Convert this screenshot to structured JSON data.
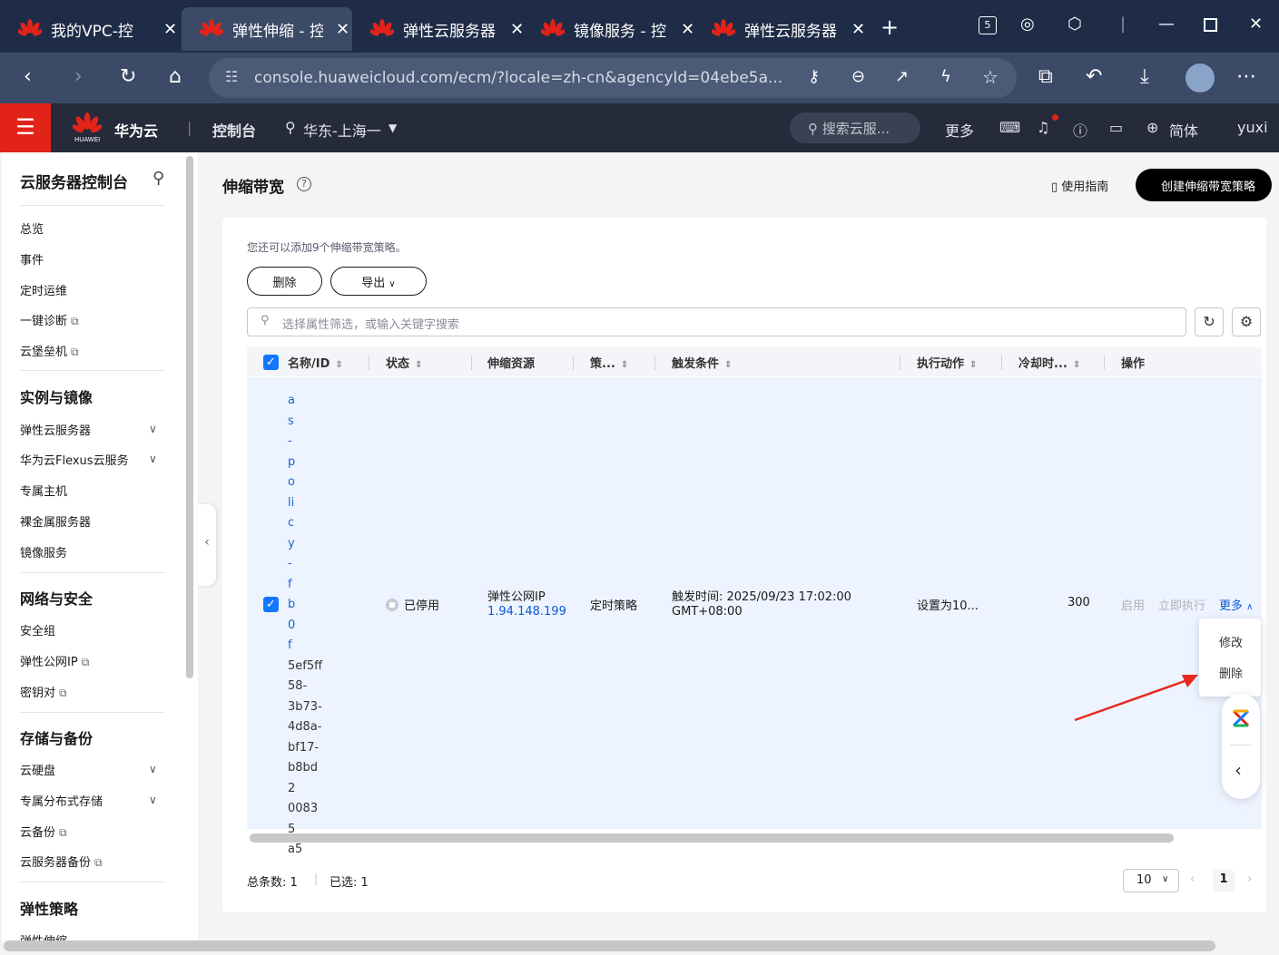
{
  "browser": {
    "tabs": [
      {
        "title": "我的VPC-控"
      },
      {
        "title": "弹性伸缩 - 控"
      },
      {
        "title": "弹性云服务器"
      },
      {
        "title": "镜像服务 - 控"
      },
      {
        "title": "弹性云服务器"
      }
    ],
    "url": "console.huaweicloud.com/ecm/?locale=zh-cn&agencyId=04ebe5a...",
    "badge": "5"
  },
  "console": {
    "brand": "华为云",
    "brand_small": "HUAWEI",
    "control": "控制台",
    "region": "华东-上海一",
    "search": "搜索云服...",
    "more": "更多",
    "lang": "简体",
    "user": "yuxi"
  },
  "sidebar": {
    "title": "云服务器控制台",
    "top_items": [
      "总览",
      "事件",
      "定时运维",
      "一键诊断",
      "云堡垒机"
    ],
    "sections": [
      {
        "title": "实例与镜像",
        "items": [
          "弹性云服务器",
          "华为云Flexus云服务",
          "专属主机",
          "裸金属服务器",
          "镜像服务"
        ]
      },
      {
        "title": "网络与安全",
        "items": [
          "安全组",
          "弹性公网IP",
          "密钥对"
        ]
      },
      {
        "title": "存储与备份",
        "items": [
          "云硬盘",
          "专属分布式存储",
          "云备份",
          "云服务器备份"
        ]
      },
      {
        "title": "弹性策略",
        "items": [
          "弹性伸缩"
        ]
      }
    ]
  },
  "page": {
    "title": "伸缩带宽",
    "guide": "使用指南",
    "create": "创建伸缩带宽策略",
    "hint": "您还可以添加9个伸缩带宽策略。",
    "delete_btn": "删除",
    "export_btn": "导出",
    "filter_placeholder": "选择属性筛选，或输入关键字搜索"
  },
  "table": {
    "headers": [
      "名称/ID",
      "状态",
      "伸缩资源",
      "策...",
      "触发条件",
      "执行动作",
      "冷却时...",
      "操作"
    ],
    "row": {
      "name_chars": [
        "a",
        "s",
        "-",
        "p",
        "o",
        "li",
        "c",
        "y",
        "-",
        "f",
        "b",
        "0",
        "f"
      ],
      "id_chunks": [
        "5ef5ff",
        "58-",
        "3b73-",
        "4d8a-",
        "bf17-",
        "b8bd2",
        "00835",
        "a5"
      ],
      "status": "已停用",
      "resource_type": "弹性公网IP",
      "resource_ip": "1.94.148.199",
      "policy_type": "定时策略",
      "trigger_line1": "触发时间: 2025/09/23 17:02:00",
      "trigger_line2": "GMT+08:00",
      "action": "设置为10...",
      "cooldown": "300",
      "op_enable": "启用",
      "op_exec": "立即执行",
      "op_more": "更多"
    }
  },
  "dropdown": {
    "items": [
      "修改",
      "删除"
    ]
  },
  "footer": {
    "total_label": "总条数:",
    "total": "1",
    "selected_label": "已选:",
    "selected": "1",
    "page_size": "10",
    "current_page": "1"
  }
}
